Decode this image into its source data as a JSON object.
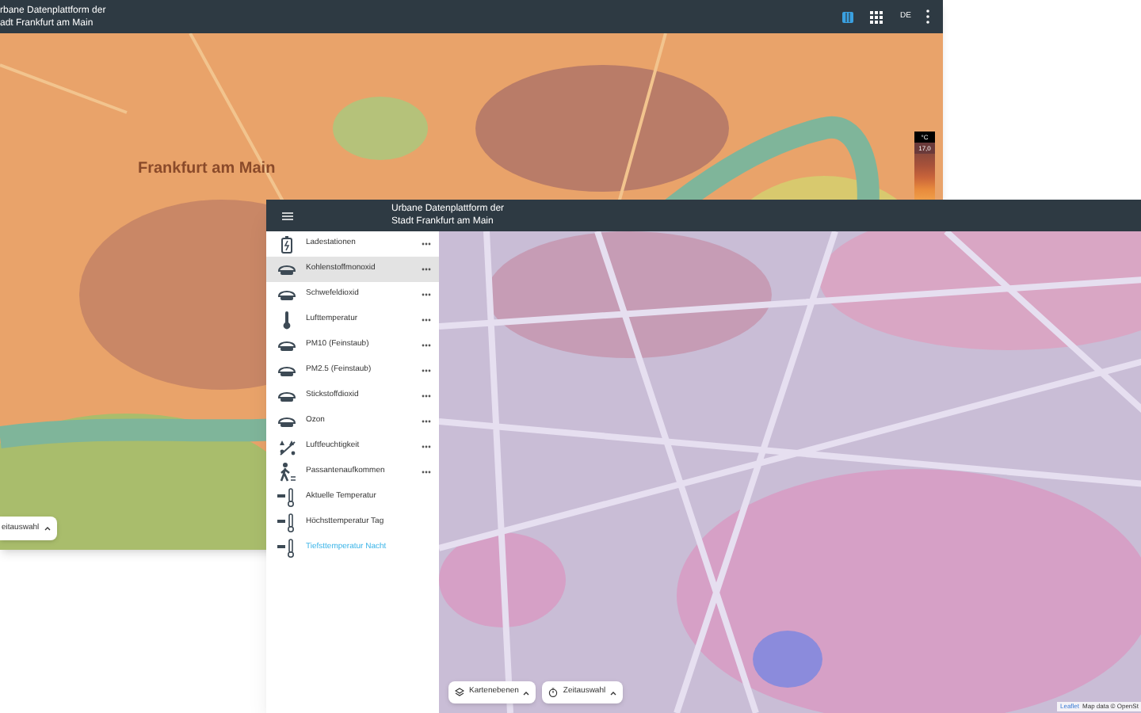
{
  "back_window": {
    "title_lines": [
      "rbane Datenplattform der",
      "adt Frankfurt am Main"
    ],
    "header_tools": [
      {
        "kind": "map",
        "selected": true
      },
      {
        "kind": "grid",
        "selected": false
      }
    ],
    "language": "DE",
    "map_label": "Frankfurt am Main",
    "legend": {
      "unit": "°C",
      "value": "17,0"
    },
    "time_button": "eitauswahl"
  },
  "front_window": {
    "title_lines": [
      "Urbane Datenplattform der",
      "Stadt Frankfurt am Main"
    ],
    "layers": [
      {
        "label": "Ladestationen",
        "kind": "station",
        "selected": false,
        "active": false
      },
      {
        "label": "Kohlenstoffmonoxid",
        "kind": "pollutant",
        "selected": true,
        "active": false
      },
      {
        "label": "Schwefeldioxid",
        "kind": "pollutant",
        "selected": false,
        "active": false
      },
      {
        "label": "Lufttemperatur",
        "kind": "thermometer",
        "selected": false,
        "active": false
      },
      {
        "label": "PM10 (Feinstaub)",
        "kind": "pollutant",
        "selected": false,
        "active": false
      },
      {
        "label": "PM2.5 (Feinstaub)",
        "kind": "pollutant",
        "selected": false,
        "active": false
      },
      {
        "label": "Stickstoffdioxid",
        "kind": "pollutant",
        "selected": false,
        "active": false
      },
      {
        "label": "Ozon",
        "kind": "pollutant",
        "selected": false,
        "active": false
      },
      {
        "label": "Luftfeuchtigkeit",
        "kind": "humidity",
        "selected": false,
        "active": false
      },
      {
        "label": "Passantenaufkommen",
        "kind": "pedestrian",
        "selected": false,
        "active": false
      },
      {
        "label": "Aktuelle Temperatur",
        "kind": "reading",
        "selected": false,
        "active": false
      },
      {
        "label": "Höchsttemperatur Tag",
        "kind": "reading",
        "selected": false,
        "active": false
      },
      {
        "label": "Tiefsttemperatur Nacht",
        "kind": "reading",
        "selected": false,
        "active": true
      }
    ],
    "bottom_buttons": [
      "Kartenebenen",
      "Zeitauswahl"
    ],
    "attribution": [
      "Leaflet",
      "Map data © OpenSt"
    ]
  }
}
